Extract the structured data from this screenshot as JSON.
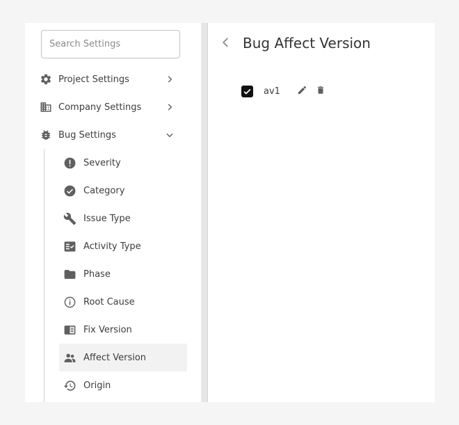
{
  "sidebar": {
    "search": {
      "placeholder": "Search Settings",
      "value": ""
    },
    "items": [
      {
        "label": "Project Settings",
        "icon": "gear-icon",
        "state": "collapsed"
      },
      {
        "label": "Company Settings",
        "icon": "building-icon",
        "state": "collapsed"
      },
      {
        "label": "Bug Settings",
        "icon": "bug-icon",
        "state": "expanded"
      }
    ],
    "bug_settings": [
      {
        "label": "Severity",
        "icon": "alert-circle-icon"
      },
      {
        "label": "Category",
        "icon": "check-circle-icon"
      },
      {
        "label": "Issue Type",
        "icon": "wrench-icon"
      },
      {
        "label": "Activity Type",
        "icon": "checklist-icon"
      },
      {
        "label": "Phase",
        "icon": "folder-icon"
      },
      {
        "label": "Root Cause",
        "icon": "info-icon"
      },
      {
        "label": "Fix Version",
        "icon": "book-icon"
      },
      {
        "label": "Affect Version",
        "icon": "people-icon",
        "active": true
      },
      {
        "label": "Origin",
        "icon": "history-icon"
      }
    ]
  },
  "content": {
    "title": "Bug Affect Version",
    "versions": [
      {
        "name": "av1",
        "checked": true
      }
    ]
  },
  "colors": {
    "icon": "#5f5f5f",
    "text": "#3c3c3c",
    "active_bg": "#f2f2f2",
    "checkbox": "#111111"
  }
}
